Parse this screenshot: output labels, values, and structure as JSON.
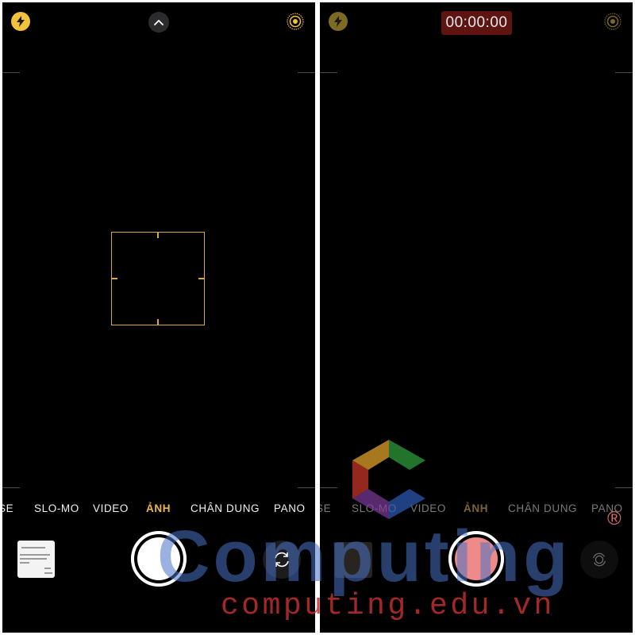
{
  "left_screen": {
    "modes": [
      "SE",
      "SLO-MO",
      "VIDEO",
      "ẢNH",
      "CHÂN DUNG",
      "PANO"
    ],
    "active_mode": "ẢNH"
  },
  "right_screen": {
    "timer": "00:00:00",
    "modes": [
      "SE",
      "SLO-MO",
      "VIDEO",
      "ẢNH",
      "CHÂN DUNG",
      "PANO"
    ],
    "active_mode": "ẢNH"
  },
  "icons": {
    "flash": "flash-icon",
    "controls": "chevron-up-icon",
    "live_photo": "live-photo-icon",
    "flip_camera": "camera-flip-icon"
  },
  "watermark": {
    "brand": "Computing",
    "registered": "®",
    "domain": "computing.edu.vn"
  },
  "colors": {
    "accent_yellow": "#f3c23c",
    "focus_frame": "#d9a84e",
    "record_red": "#ee8b88",
    "timer_bg": "#5e1411"
  }
}
